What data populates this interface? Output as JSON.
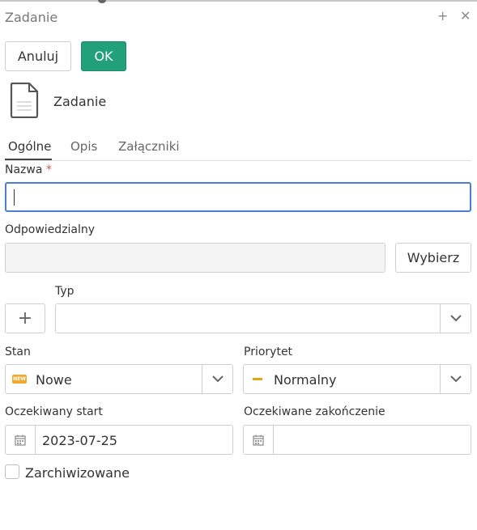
{
  "window": {
    "title": "Zadanie",
    "add_icon": "plus-icon",
    "close_icon": "close-icon"
  },
  "toolbar": {
    "cancel_label": "Anuluj",
    "ok_label": "OK",
    "ok_color": "#22a07a"
  },
  "header": {
    "icon": "document-icon",
    "label": "Zadanie"
  },
  "tabs": [
    {
      "label": "Ogólne",
      "active": true
    },
    {
      "label": "Opis",
      "active": false
    },
    {
      "label": "Załączniki",
      "active": false
    }
  ],
  "form": {
    "name": {
      "label": "Nazwa",
      "required_mark": "*",
      "value": ""
    },
    "responsible": {
      "label": "Odpowiedzialny",
      "value": "",
      "choose_label": "Wybierz"
    },
    "type": {
      "label": "Typ",
      "value": "",
      "add_icon": "plus-icon"
    },
    "status": {
      "label": "Stan",
      "value": "Nowe",
      "icon": "new-badge-icon",
      "icon_text": "NEW",
      "icon_color": "#e8a317"
    },
    "priority": {
      "label": "Priorytet",
      "value": "Normalny",
      "icon": "dash-icon",
      "icon_color": "#e8a317"
    },
    "expected_start": {
      "label": "Oczekiwany start",
      "value": "2023-07-25"
    },
    "expected_end": {
      "label": "Oczekiwane zakończenie",
      "value": ""
    },
    "archived": {
      "label": "Zarchiwizowane",
      "checked": false
    }
  }
}
